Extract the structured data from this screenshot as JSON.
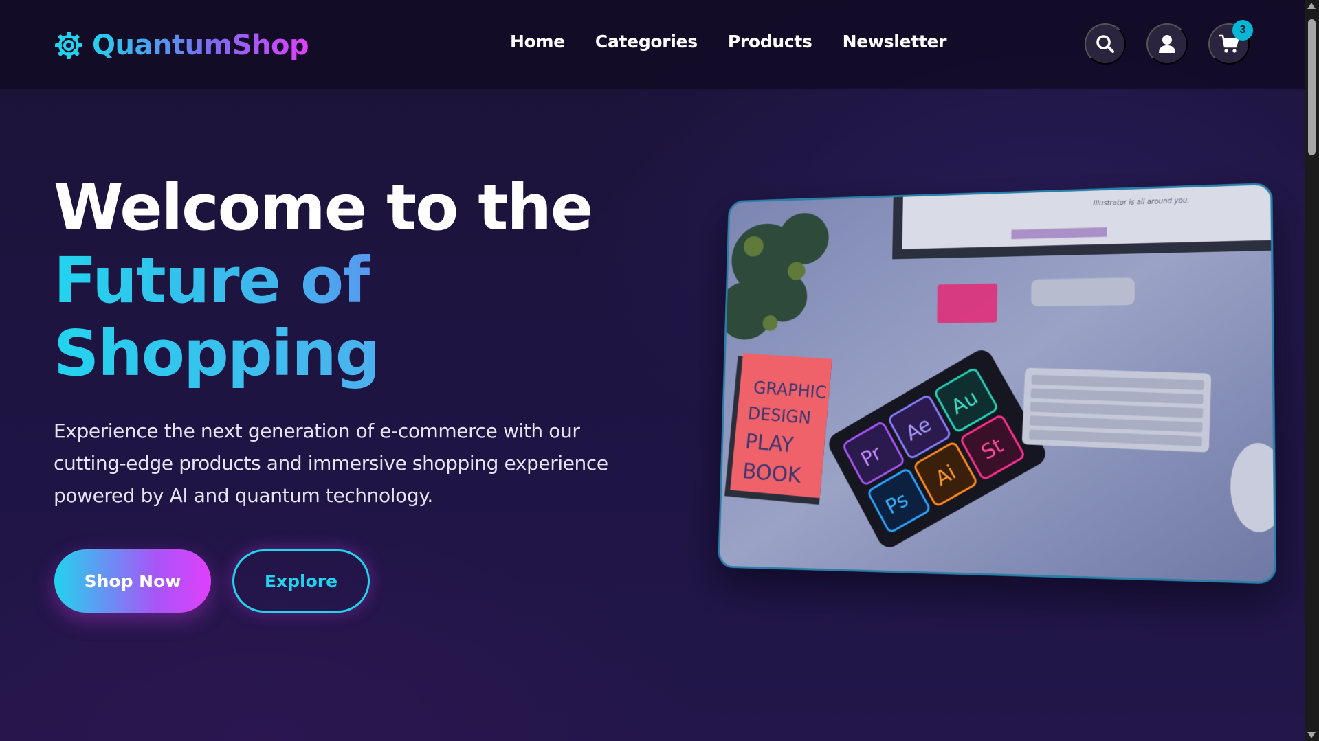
{
  "brand": {
    "name": "QuantumShop",
    "icon": "atom-gear-icon",
    "accent": "#22d3ee",
    "accent2": "#e040fb"
  },
  "nav": {
    "links": [
      {
        "label": "Home"
      },
      {
        "label": "Categories"
      },
      {
        "label": "Products"
      },
      {
        "label": "Newsletter"
      }
    ],
    "actions": {
      "search_icon": "search-icon",
      "user_icon": "user-icon",
      "cart_icon": "cart-icon",
      "cart_count": "3"
    }
  },
  "hero": {
    "title_line1": "Welcome to the",
    "title_line2": "Future of",
    "title_line3": "Shopping",
    "description": "Experience the next generation of e-commerce with our cutting-edge products and immersive shopping experience powered by AI and quantum technology.",
    "primary_button": "Shop Now",
    "secondary_button": "Explore",
    "image": {
      "book_title": "GRAPHIC DESIGN PLAY BOOK",
      "app_tiles": [
        "Pr",
        "Ae",
        "Au",
        "Ps",
        "Ai",
        "St"
      ],
      "monitor_text": "Illustrator is all around you."
    }
  }
}
